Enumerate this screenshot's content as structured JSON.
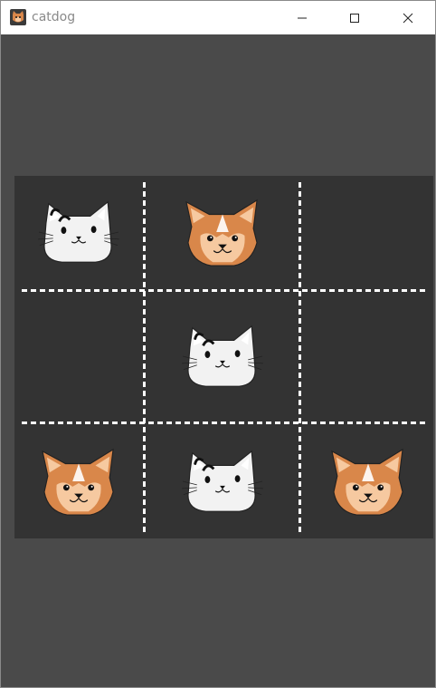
{
  "window": {
    "title": "catdog",
    "app_icon": "catdog-app-icon",
    "controls": [
      "minimize-icon",
      "maximize-icon",
      "close-icon"
    ]
  },
  "colors": {
    "client_background": "#4a4a4a",
    "board_background": "#333333",
    "grid_line": "#ffffff",
    "cat_fill": "#f2f2f2",
    "dog_fill": "#d9874a",
    "dog_light": "#f6c9a0"
  },
  "board": {
    "rows": 3,
    "cols": 3,
    "cells": [
      [
        "cat",
        "dog",
        "empty"
      ],
      [
        "empty",
        "cat",
        "empty"
      ],
      [
        "dog",
        "cat",
        "dog"
      ]
    ]
  }
}
